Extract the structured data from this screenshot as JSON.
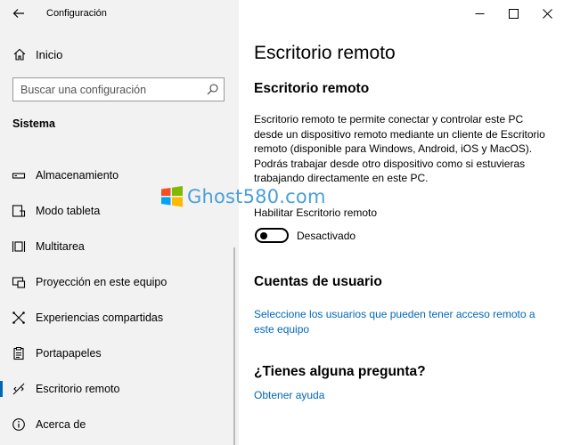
{
  "window": {
    "title": "Configuración"
  },
  "sidebar": {
    "home_label": "Inicio",
    "search_placeholder": "Buscar una configuración",
    "section_label": "Sistema",
    "items": [
      {
        "label": "Almacenamiento",
        "icon": "storage-icon"
      },
      {
        "label": "Modo tableta",
        "icon": "tablet-mode-icon"
      },
      {
        "label": "Multitarea",
        "icon": "multitasking-icon"
      },
      {
        "label": "Proyección en este equipo",
        "icon": "projection-icon"
      },
      {
        "label": "Experiencias compartidas",
        "icon": "shared-experiences-icon"
      },
      {
        "label": "Portapapeles",
        "icon": "clipboard-icon"
      },
      {
        "label": "Escritorio remoto",
        "icon": "remote-desktop-icon",
        "active": true
      },
      {
        "label": "Acerca de",
        "icon": "info-icon"
      }
    ]
  },
  "main": {
    "page_title": "Escritorio remoto",
    "section1_title": "Escritorio remoto",
    "description": "Escritorio remoto te permite conectar y controlar este PC desde un dispositivo remoto mediante un cliente de Escritorio remoto (disponible para Windows, Android, iOS y MacOS). Podrás trabajar desde otro dispositivo como si estuvieras trabajando directamente en este PC.",
    "toggle_caption": "Habilitar Escritorio remoto",
    "toggle_state": "Desactivado",
    "toggle_on": false,
    "section2_title": "Cuentas de usuario",
    "users_link": "Seleccione los usuarios que pueden tener acceso remoto a este equipo",
    "section3_title": "¿Tienes alguna pregunta?",
    "help_link": "Obtener ayuda"
  },
  "watermark": {
    "text": "Ghost580.com"
  },
  "colors": {
    "accent": "#0067b8",
    "sidebar_bg": "#f2f2f2",
    "watermark": "#4a9fd8"
  }
}
